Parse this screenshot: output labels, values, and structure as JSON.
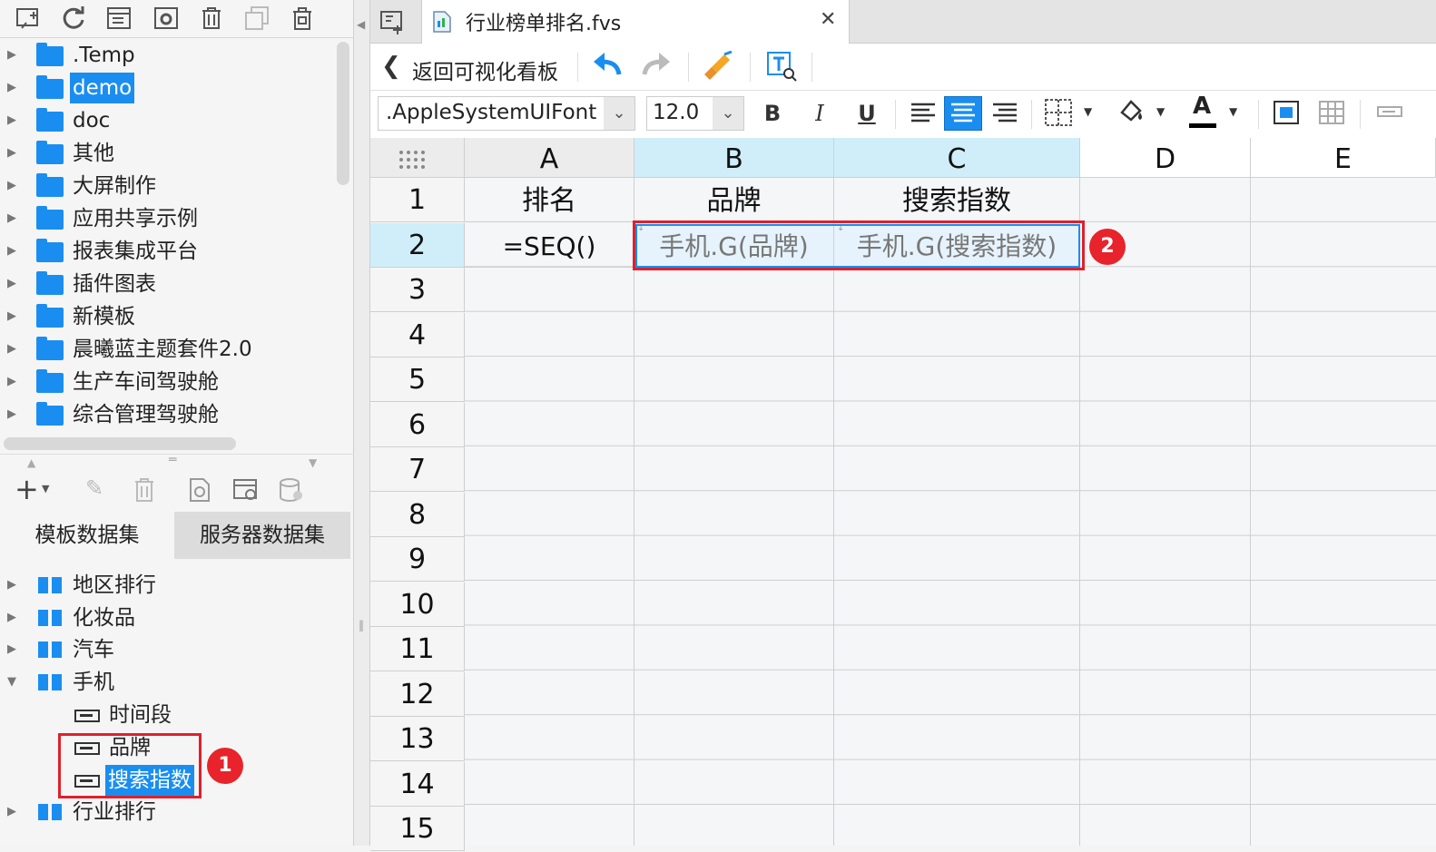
{
  "top_toolbar": {
    "icons": [
      "new-template-icon",
      "refresh-icon",
      "template-info-icon",
      "settings-icon",
      "delete-icon",
      "copy-icon",
      "lock-icon"
    ]
  },
  "folders": [
    ".Temp",
    "demo",
    "doc",
    "其他",
    "大屏制作",
    "应用共享示例",
    "报表集成平台",
    "插件图表",
    "新模板",
    "晨曦蓝主题套件2.0",
    "生产车间驾驶舱",
    "综合管理驾驶舱"
  ],
  "dataset_tabs": {
    "template": "模板数据集",
    "server": "服务器数据集"
  },
  "datasets": {
    "items": [
      "地区排行",
      "化妆品",
      "汽车",
      "手机",
      "行业排行"
    ],
    "fields": [
      "时间段",
      "品牌",
      "搜索指数"
    ]
  },
  "annotations": {
    "badge1": "1",
    "badge2": "2"
  },
  "editor": {
    "tab_title": "行业榜单排名.fvs",
    "back_label": "返回可视化看板",
    "font_name": ".AppleSystemUIFont",
    "font_size": "12.0",
    "bold": "B",
    "italic": "I",
    "underline": "U",
    "font_color": "A"
  },
  "sheet": {
    "columns": [
      "A",
      "B",
      "C",
      "D",
      "E"
    ],
    "rows": [
      "1",
      "2",
      "3",
      "4",
      "5",
      "6",
      "7",
      "8",
      "9",
      "10",
      "11",
      "12",
      "13",
      "14",
      "15"
    ],
    "cells": {
      "A1": "排名",
      "B1": "品牌",
      "C1": "搜索指数",
      "A2": "=SEQ()",
      "B2": "手机.G(品牌)",
      "C2": "手机.G(搜索指数)"
    }
  },
  "colors": {
    "accent": "#1a8ef0",
    "highlight": "#e0202a",
    "selected_header": "#cfeefa"
  }
}
